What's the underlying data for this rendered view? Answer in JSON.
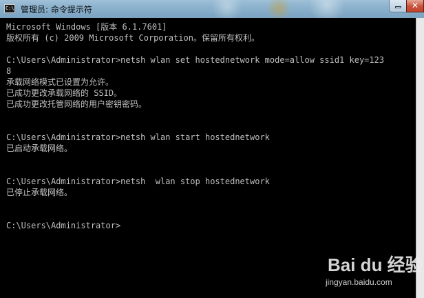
{
  "window": {
    "title": "管理员: 命令提示符",
    "icon_text": "C:\\"
  },
  "console": {
    "lines": [
      "Microsoft Windows [版本 6.1.7601]",
      "版权所有 (c) 2009 Microsoft Corporation。保留所有权利。",
      "",
      "C:\\Users\\Administrator>netsh wlan set hostednetwork mode=allow ssid1 key=123",
      "8",
      "承载网络模式已设置为允许。",
      "已成功更改承载网络的 SSID。",
      "已成功更改托管网络的用户密钥密码。",
      "",
      "",
      "C:\\Users\\Administrator>netsh wlan start hostednetwork",
      "已启动承载网络。",
      "",
      "",
      "C:\\Users\\Administrator>netsh  wlan stop hostednetwork",
      "已停止承载网络。",
      "",
      "",
      "C:\\Users\\Administrator>"
    ]
  },
  "watermark": {
    "text": "Bai du 经验",
    "url": "jingyan.baidu.com"
  },
  "colors": {
    "console_background": "#000000",
    "console_text": "#c0c0c0",
    "titlebar": "#8cb2cd",
    "close_button": "#c7513b"
  },
  "icons": [
    "cmd-icon",
    "minimize-icon",
    "close-icon"
  ]
}
